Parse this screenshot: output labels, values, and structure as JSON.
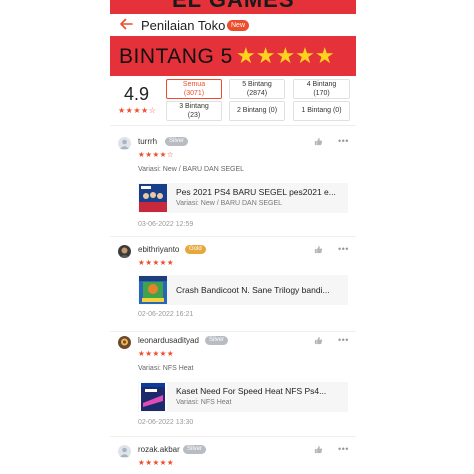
{
  "top_banner": {
    "text": "EL GAMES"
  },
  "header": {
    "title": "Penilaian Toko",
    "badge": "New"
  },
  "banner": {
    "text": "BINTANG 5",
    "stars": "★★★★★"
  },
  "summary": {
    "score": "4.9",
    "stars": "★★★★☆",
    "filters": [
      {
        "label": "Semua",
        "count": "(3071)",
        "active": true
      },
      {
        "label": "5 Bintang",
        "count": "(2874)",
        "active": false
      },
      {
        "label": "4 Bintang",
        "count": "(170)",
        "active": false
      },
      {
        "label": "3 Bintang",
        "count": "(23)",
        "active": false
      },
      {
        "label": "2 Bintang (0)",
        "count": "",
        "active": false
      },
      {
        "label": "1 Bintang (0)",
        "count": "",
        "active": false
      }
    ]
  },
  "reviews": [
    {
      "username": "turrrh",
      "badge": "Silver",
      "stars": "★★★★☆",
      "variasi": "Variasi: New / BARU DAN SEGEL",
      "product": {
        "name": "Pes 2021 PS4 BARU SEGEL pes2021 e...",
        "variasi": "Variasi: New / BARU DAN SEGEL"
      },
      "date": "03-06-2022 12:59"
    },
    {
      "username": "ebithriyanto",
      "badge": "Gold",
      "stars": "★★★★★",
      "variasi": "",
      "product": {
        "name": "Crash Bandicoot N. Sane Trilogy bandi...",
        "variasi": ""
      },
      "date": "02-06-2022 16:21"
    },
    {
      "username": "leonardusadityad",
      "badge": "Silver",
      "stars": "★★★★★",
      "variasi": "Variasi: NFS Heat",
      "product": {
        "name": "Kaset Need For Speed Heat NFS Ps4...",
        "variasi": "Variasi: NFS Heat"
      },
      "date": "02-06-2022 13:30"
    },
    {
      "username": "rozak.akbar",
      "badge": "Silver",
      "stars": "★★★★★"
    }
  ],
  "colors": {
    "brand": "#ee4d2d",
    "banner": "#e5313a",
    "star": "#ffd21f"
  }
}
